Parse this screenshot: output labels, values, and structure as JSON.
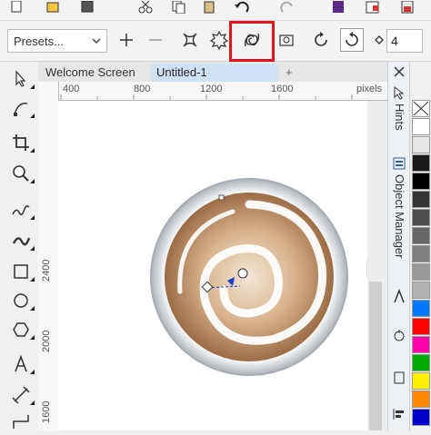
{
  "property_bar": {
    "presets_value": "Presets...",
    "spin_value": "4"
  },
  "tabs": {
    "welcome": "Welcome Screen",
    "untitled": "Untitled-1",
    "add": "+"
  },
  "ruler": {
    "units": "pixels",
    "h_ticks": [
      "400",
      "800",
      "1200",
      "1600"
    ],
    "v_ticks": [
      "2400",
      "2000",
      "1600"
    ]
  },
  "dockers": {
    "hints": "Hints",
    "object_manager": "Object Manager"
  },
  "palette": [
    "none",
    "#ffffff",
    "#e6e6e6",
    "#1a1a1a",
    "#000000",
    "#333333",
    "#4d4d4d",
    "#666666",
    "#808080",
    "#999999",
    "#b3b3b3",
    "#0077ff",
    "#ff0000",
    "#ff00aa",
    "#00aa00",
    "#ffee00",
    "#ff8800",
    "#0000cc"
  ],
  "colors": {
    "highlight": "#e0141a",
    "active_tab": "#cfe3f7"
  },
  "tools": [
    "pick-tool",
    "shape-tool",
    "crop-tool",
    "zoom-tool",
    "freehand-tool",
    "artistic-media-tool",
    "rectangle-tool",
    "ellipse-tool",
    "polygon-tool",
    "text-tool",
    "parallel-dimension-tool",
    "connector-tool"
  ]
}
